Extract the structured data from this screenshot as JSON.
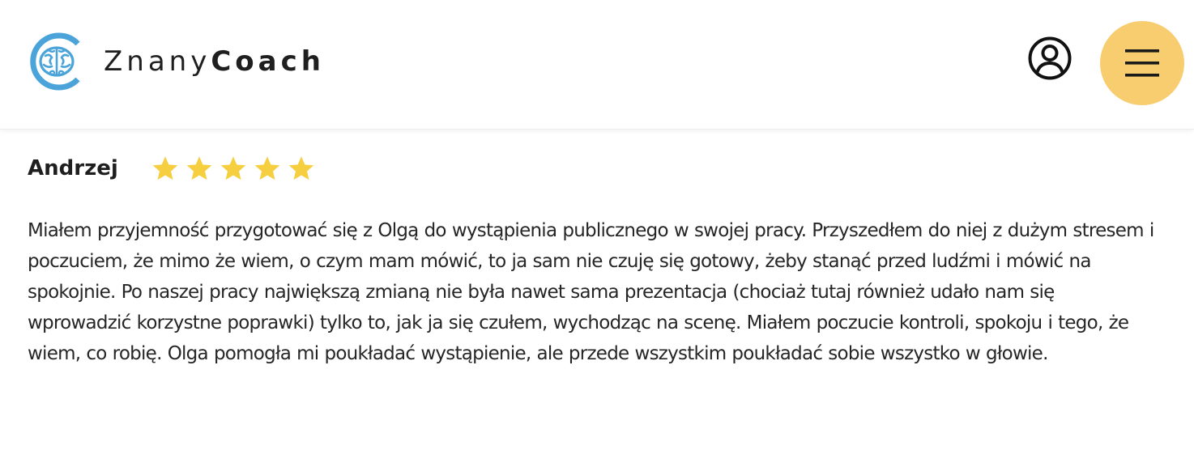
{
  "header": {
    "logo_text_light": "Znany",
    "logo_text_bold": "Coach",
    "logo_icon": "brain-icon",
    "user_icon": "user-account-icon",
    "menu_icon": "hamburger-menu-icon",
    "colors": {
      "brand_blue": "#4aa3d9",
      "menu_yellow": "#f8cd70",
      "text_dark": "#1f1f1f"
    }
  },
  "review": {
    "author": "Andrzej",
    "rating": 5,
    "rating_max": 5,
    "star_color": "#f5cf3f",
    "text": "Miałem przyjemność przygotować się z Olgą do wystąpienia publicznego w swojej pracy. Przyszedłem do niej z dużym stresem i poczuciem, że mimo że wiem, o czym mam mówić, to ja sam nie czuję się gotowy, żeby stanąć przed ludźmi i mówić na spokojnie. Po naszej pracy największą zmianą nie była nawet sama prezentacja (chociaż tutaj również udało nam się wprowadzić korzystne poprawki) tylko to, jak ja się czułem, wychodząc na scenę. Miałem poczucie kontroli, spokoju i tego, że wiem, co robię. Olga pomogła mi poukładać wystąpienie, ale przede wszystkim poukładać sobie wszystko w głowie."
  }
}
